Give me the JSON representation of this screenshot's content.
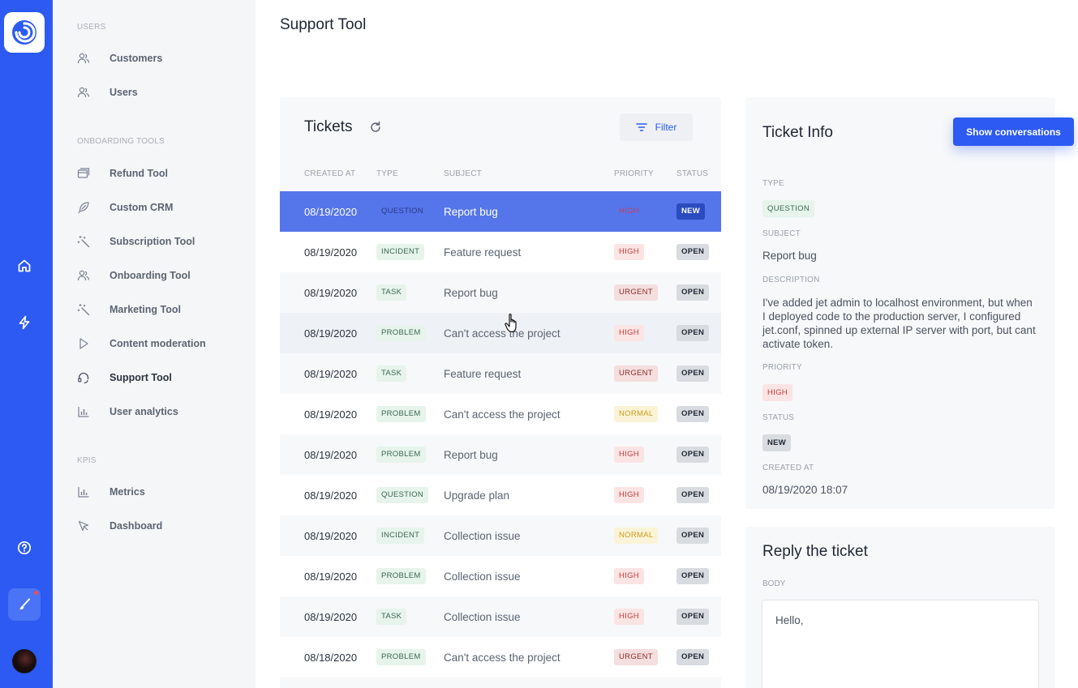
{
  "app": {
    "title": "Support Tool",
    "brand_color": "#2c5af2",
    "rail_icons": [
      "logo-icon",
      "home-icon",
      "lightning-icon",
      "help-icon",
      "brush-icon"
    ]
  },
  "sidebar": {
    "sections": [
      {
        "label": "USERS",
        "items": [
          {
            "label": "Customers",
            "icon": "users-icon"
          },
          {
            "label": "Users",
            "icon": "users-icon"
          }
        ]
      },
      {
        "label": "ONBOARDING TOOLS",
        "items": [
          {
            "label": "Refund Tool",
            "icon": "cards-icon"
          },
          {
            "label": "Custom CRM",
            "icon": "feather-icon"
          },
          {
            "label": "Subscription Tool",
            "icon": "magic-wand-icon"
          },
          {
            "label": "Onboarding Tool",
            "icon": "users-icon"
          },
          {
            "label": "Marketing Tool",
            "icon": "magic-wand-icon"
          },
          {
            "label": "Content moderation",
            "icon": "play-icon"
          },
          {
            "label": "Support Tool",
            "icon": "headset-icon"
          },
          {
            "label": "User analytics",
            "icon": "bar-chart-icon"
          }
        ]
      },
      {
        "label": "KPIS",
        "items": [
          {
            "label": "Metrics",
            "icon": "bar-chart-icon"
          },
          {
            "label": "Dashboard",
            "icon": "pointer-icon"
          }
        ]
      }
    ]
  },
  "tickets": {
    "title": "Tickets",
    "filter_label": "Filter",
    "columns": [
      "CREATED AT",
      "TYPE",
      "SUBJECT",
      "PRIORITY",
      "STATUS"
    ],
    "rows": [
      {
        "date": "08/19/2020",
        "type": "QUESTION",
        "subject": "Report bug",
        "priority": "HIGH",
        "status": "NEW"
      },
      {
        "date": "08/19/2020",
        "type": "INCIDENT",
        "subject": "Feature request",
        "priority": "HIGH",
        "status": "OPEN"
      },
      {
        "date": "08/19/2020",
        "type": "TASK",
        "subject": "Report bug",
        "priority": "URGENT",
        "status": "OPEN"
      },
      {
        "date": "08/19/2020",
        "type": "PROBLEM",
        "subject": "Can't access the project",
        "priority": "HIGH",
        "status": "OPEN"
      },
      {
        "date": "08/19/2020",
        "type": "TASK",
        "subject": "Feature request",
        "priority": "URGENT",
        "status": "OPEN"
      },
      {
        "date": "08/19/2020",
        "type": "PROBLEM",
        "subject": "Can't access the project",
        "priority": "NORMAL",
        "status": "OPEN"
      },
      {
        "date": "08/19/2020",
        "type": "PROBLEM",
        "subject": "Report bug",
        "priority": "HIGH",
        "status": "OPEN"
      },
      {
        "date": "08/19/2020",
        "type": "QUESTION",
        "subject": "Upgrade plan",
        "priority": "HIGH",
        "status": "OPEN"
      },
      {
        "date": "08/19/2020",
        "type": "INCIDENT",
        "subject": "Collection issue",
        "priority": "NORMAL",
        "status": "OPEN"
      },
      {
        "date": "08/19/2020",
        "type": "PROBLEM",
        "subject": "Collection issue",
        "priority": "HIGH",
        "status": "OPEN"
      },
      {
        "date": "08/19/2020",
        "type": "TASK",
        "subject": "Collection issue",
        "priority": "HIGH",
        "status": "OPEN"
      },
      {
        "date": "08/18/2020",
        "type": "PROBLEM",
        "subject": "Can't access the project",
        "priority": "URGENT",
        "status": "OPEN"
      }
    ]
  },
  "ticket_info": {
    "title": "Ticket Info",
    "show_conversations_label": "Show conversations",
    "type_label": "TYPE",
    "type": "QUESTION",
    "subject_label": "SUBJECT",
    "subject": "Report bug",
    "description_label": "DESCRIPTION",
    "description": "I've added jet admin to localhost environment, but when I deployed code to the production server, I configured jet.conf, spinned up external IP server with port, but cant activate token.",
    "priority_label": "PRIORITY",
    "priority": "HIGH",
    "status_label": "STATUS",
    "status": "NEW",
    "created_label": "CREATED AT",
    "created": "08/19/2020 18:07"
  },
  "reply": {
    "title": "Reply the ticket",
    "body_label": "BODY",
    "body": "Hello,"
  }
}
